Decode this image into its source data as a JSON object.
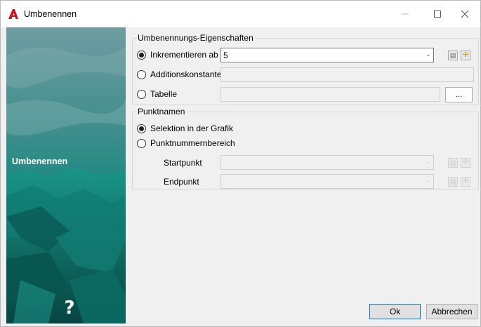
{
  "window": {
    "title": "Umbenennen",
    "accent_color": "#c8151b"
  },
  "side_panel": {
    "label": "Umbenennen",
    "help_icon": "?",
    "colors": {
      "top": "#4f8a8c",
      "teal": "#13968a",
      "dark": "#073f3d"
    }
  },
  "group_properties": {
    "title": "Umbenennungs-Eigenschaften",
    "options": [
      {
        "label": "Inkrementieren ab",
        "selected": true
      },
      {
        "label": "Additionskonstante",
        "selected": false
      },
      {
        "label": "Tabelle",
        "selected": false
      }
    ],
    "increment_value": "5",
    "dropdown_dash": "-",
    "table_button_label": "..."
  },
  "group_points": {
    "title": "Punktnamen",
    "options": [
      {
        "label": "Selektion in der Grafik",
        "selected": true
      },
      {
        "label": "Punktnummernbereich",
        "selected": false
      }
    ],
    "fields": [
      {
        "label": "Startpunkt",
        "value": "",
        "dash": "-"
      },
      {
        "label": "Endpunkt",
        "value": "",
        "dash": "-"
      }
    ]
  },
  "buttons": {
    "ok": "Ok",
    "cancel": "Abbrechen"
  },
  "icons": {
    "calculator": "calculator-icon",
    "pick": "pick-point-icon",
    "minimize": "minimize-icon",
    "maximize": "maximize-icon",
    "close": "close-icon"
  }
}
